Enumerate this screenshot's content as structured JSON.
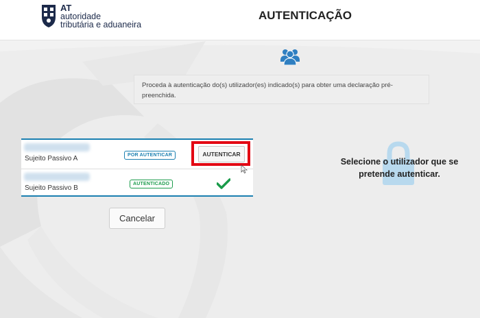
{
  "header": {
    "logo": {
      "abbr": "AT",
      "line1": "autoridade",
      "line2": "tributária e aduaneira"
    },
    "title": "AUTENTICAÇÃO"
  },
  "info": {
    "text": "Proceda à autenticação do(s) utilizador(es) indicado(s) para obter uma declaração pré-preenchida."
  },
  "table": {
    "rows": [
      {
        "subject": "Sujeito Passivo A",
        "status": "POR AUTENTICAR",
        "action_label": "AUTENTICAR"
      },
      {
        "subject": "Sujeito Passivo B",
        "status": "AUTENTICADO"
      }
    ]
  },
  "actions": {
    "cancel_label": "Cancelar"
  },
  "side": {
    "message": "Selecione o utilizador que se pretende autenticar."
  },
  "colors": {
    "accent_blue": "#1a7fb0",
    "success_green": "#1a9b4a",
    "highlight_red": "#e30613",
    "lock_blue": "#b8d9ee",
    "users_icon": "#2f7fc1"
  },
  "icons": {
    "users": "users-group-icon",
    "check": "checkmark-icon",
    "lock": "padlock-icon",
    "cursor": "mouse-pointer-icon",
    "logo": "at-emblem-icon"
  }
}
